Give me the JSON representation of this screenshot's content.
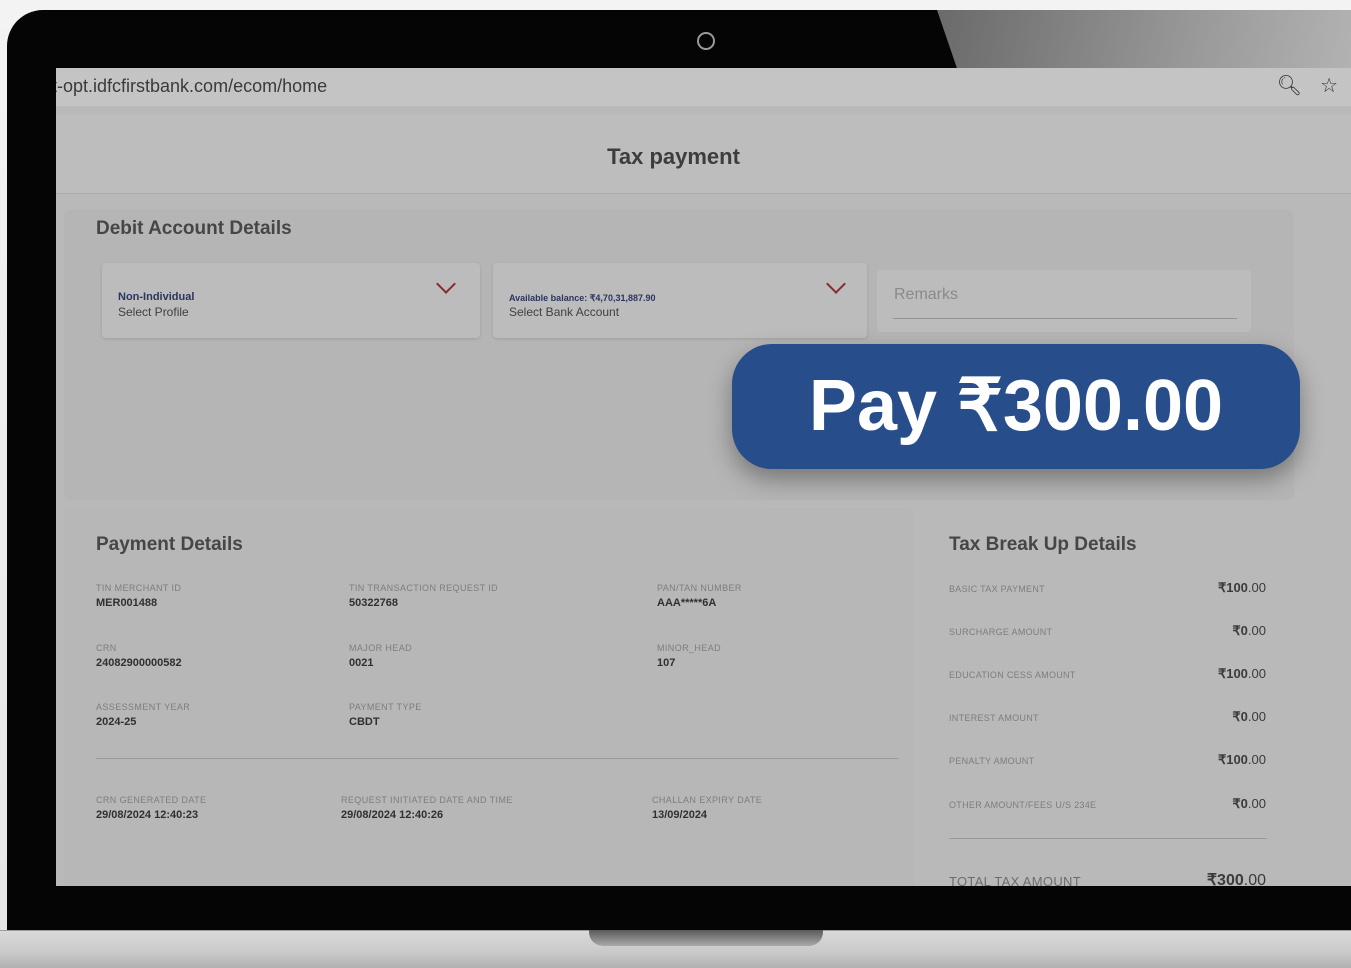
{
  "browser": {
    "url": "t-opt.idfcfirstbank.com/ecom/home",
    "tools": [
      "zoom-icon",
      "star-icon"
    ]
  },
  "header": {
    "title": "Tax payment"
  },
  "debit": {
    "section_title": "Debit Account Details",
    "profile": {
      "value": "Non-Individual",
      "label": "Select Profile"
    },
    "bank_account": {
      "value": "Available balance: ₹4,70,31,887.90",
      "label": "Select Bank Account"
    },
    "remarks_placeholder": "Remarks"
  },
  "pay_button": {
    "label": "Pay ₹300.00"
  },
  "payment_details": {
    "section_title": "Payment Details",
    "fields": [
      {
        "label": "TIN MERCHANT ID",
        "value": "MER001488"
      },
      {
        "label": "TIN TRANSACTION REQUEST ID",
        "value": "50322768"
      },
      {
        "label": "PAN/TAN NUMBER",
        "value": "AAA*****6A"
      },
      {
        "label": "CRN",
        "value": "24082900000582"
      },
      {
        "label": "MAJOR HEAD",
        "value": "0021"
      },
      {
        "label": "MINOR_HEAD",
        "value": "107"
      },
      {
        "label": "ASSESSMENT YEAR",
        "value": "2024-25"
      },
      {
        "label": "PAYMENT TYPE",
        "value": "CBDT"
      }
    ],
    "dates": [
      {
        "label": "CRN GENERATED DATE",
        "value": "29/08/2024 12:40:23"
      },
      {
        "label": "REQUEST INITIATED DATE AND TIME",
        "value": "29/08/2024 12:40:26"
      },
      {
        "label": "CHALLAN EXPIRY DATE",
        "value": "13/09/2024"
      }
    ]
  },
  "tax_breakup": {
    "section_title": "Tax Break Up Details",
    "rows": [
      {
        "label": "BASIC TAX PAYMENT",
        "amount": "₹100",
        "decimals": ".00"
      },
      {
        "label": "SURCHARGE AMOUNT",
        "amount": "₹0",
        "decimals": ".00"
      },
      {
        "label": "EDUCATION CESS AMOUNT",
        "amount": "₹100",
        "decimals": ".00"
      },
      {
        "label": "INTEREST AMOUNT",
        "amount": "₹0",
        "decimals": ".00"
      },
      {
        "label": "PENALTY AMOUNT",
        "amount": "₹100",
        "decimals": ".00"
      },
      {
        "label": "OTHER AMOUNT/FEES U/S 234E",
        "amount": "₹0",
        "decimals": ".00"
      }
    ],
    "total": {
      "label": "TOTAL TAX AMOUNT",
      "amount": "₹300",
      "decimals": ".00"
    }
  }
}
